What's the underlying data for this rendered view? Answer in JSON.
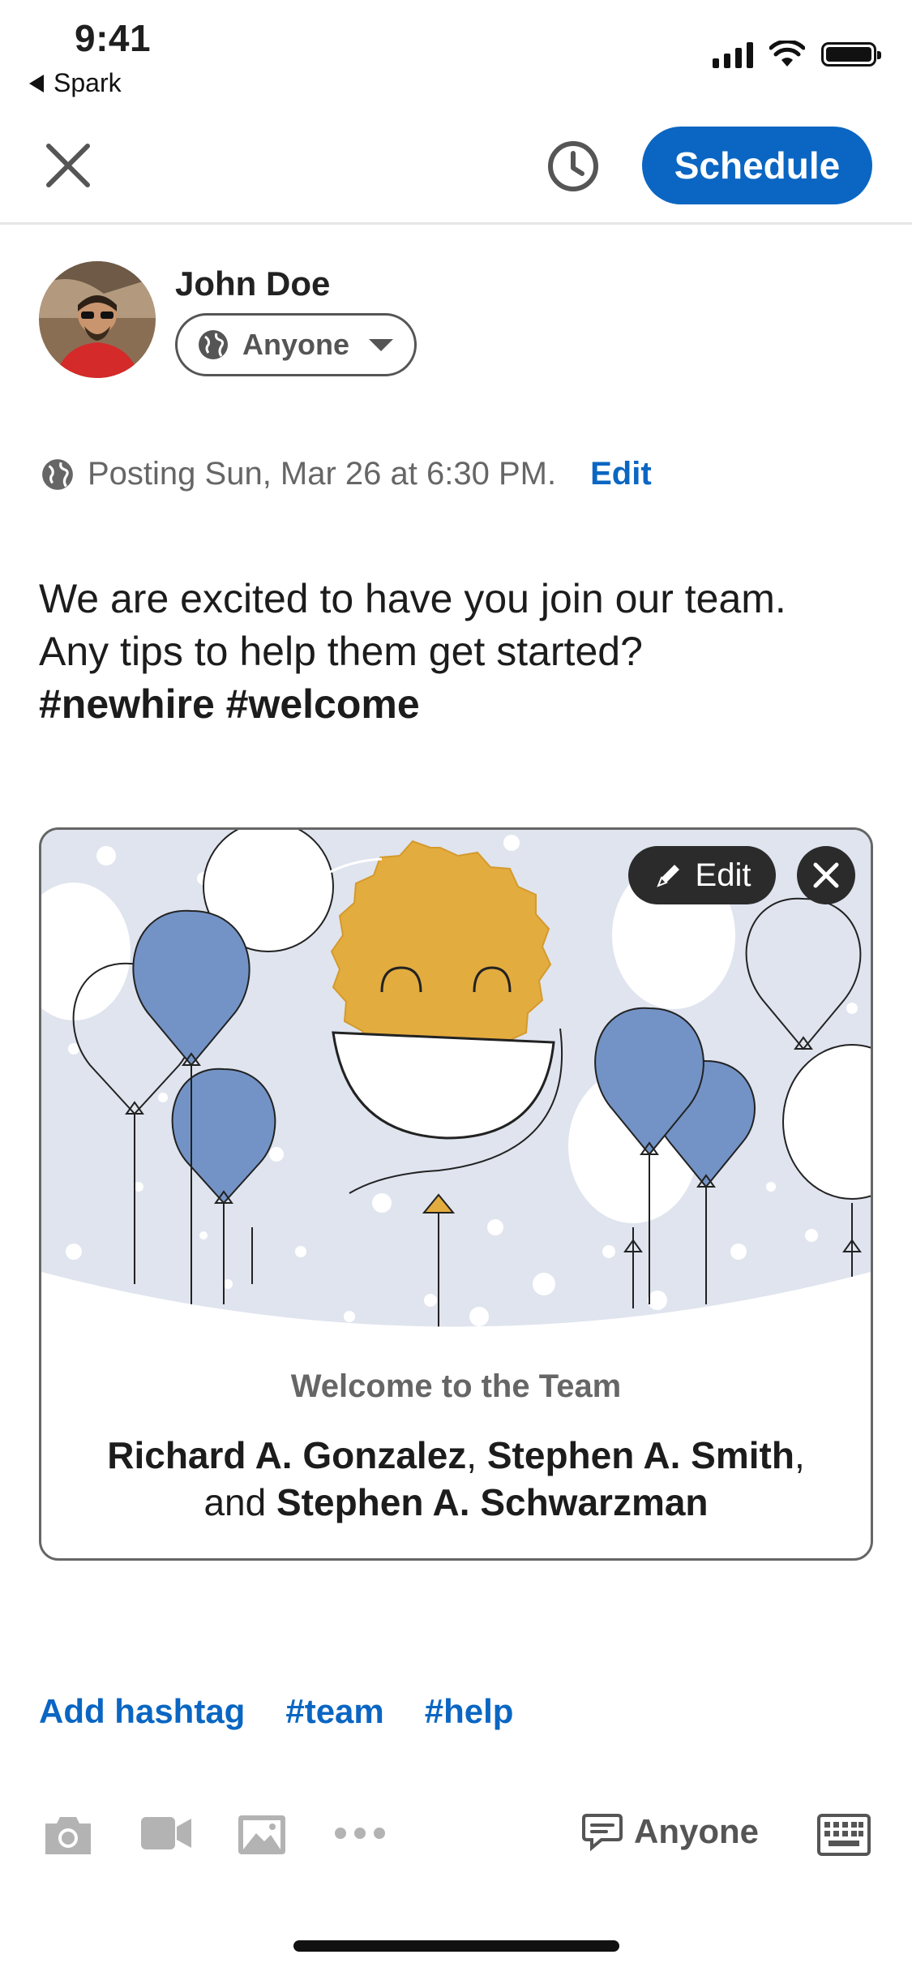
{
  "status_bar": {
    "time": "9:41",
    "back_app": "Spark"
  },
  "header": {
    "schedule_label": "Schedule"
  },
  "author": {
    "name": "John Doe",
    "audience": "Anyone"
  },
  "posting": {
    "text": "Posting Sun, Mar 26 at 6:30 PM.",
    "edit_label": "Edit"
  },
  "post": {
    "line1": "We are excited to have you join our team.",
    "line2": "Any tips to help them get started?",
    "tags": "#newhire #welcome"
  },
  "card": {
    "edit_label": "Edit",
    "subtitle": "Welcome to the Team",
    "name1": "Richard A. Gonzalez",
    "sep1": ", ",
    "name2": "Stephen A. Smith",
    "sep2": ", and ",
    "name3": "Stephen A. Schwarzman"
  },
  "hashtags": [
    "Add hashtag",
    "#team",
    "#help"
  ],
  "toolbar": {
    "comment_audience": "Anyone"
  },
  "colors": {
    "accent": "#0a66c2",
    "balloon_blue": "#7393c6",
    "smiley_gold": "#e3ac3e",
    "card_bg": "#dfe4ee"
  }
}
